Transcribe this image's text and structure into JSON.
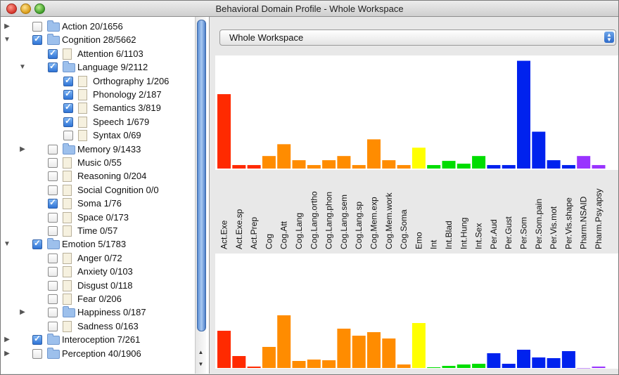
{
  "window": {
    "title": "Behavioral Domain Profile - Whole Workspace"
  },
  "tree": [
    {
      "level": 0,
      "disclosure": "collapsed",
      "checked": false,
      "icon": "folder-icon",
      "label": "Action 20/1656"
    },
    {
      "level": 0,
      "disclosure": "expanded",
      "checked": true,
      "icon": "folder-icon",
      "label": "Cognition 28/5662"
    },
    {
      "level": 1,
      "disclosure": "none",
      "checked": true,
      "icon": "document-icon",
      "label": "Attention 6/1103"
    },
    {
      "level": 1,
      "disclosure": "expanded",
      "checked": true,
      "icon": "folder-icon",
      "label": "Language 9/2112"
    },
    {
      "level": 2,
      "disclosure": "none",
      "checked": true,
      "icon": "document-icon",
      "label": "Orthography 1/206"
    },
    {
      "level": 2,
      "disclosure": "none",
      "checked": true,
      "icon": "document-icon",
      "label": "Phonology 2/187"
    },
    {
      "level": 2,
      "disclosure": "none",
      "checked": true,
      "icon": "document-icon",
      "label": "Semantics 3/819"
    },
    {
      "level": 2,
      "disclosure": "none",
      "checked": true,
      "icon": "document-icon",
      "label": "Speech 1/679"
    },
    {
      "level": 2,
      "disclosure": "none",
      "checked": false,
      "icon": "document-icon",
      "label": "Syntax 0/69"
    },
    {
      "level": 1,
      "disclosure": "collapsed",
      "checked": false,
      "icon": "folder-icon",
      "label": "Memory 9/1433"
    },
    {
      "level": 1,
      "disclosure": "none",
      "checked": false,
      "icon": "document-icon",
      "label": "Music 0/55"
    },
    {
      "level": 1,
      "disclosure": "none",
      "checked": false,
      "icon": "document-icon",
      "label": "Reasoning 0/204"
    },
    {
      "level": 1,
      "disclosure": "none",
      "checked": false,
      "icon": "document-icon",
      "label": "Social Cognition 0/0"
    },
    {
      "level": 1,
      "disclosure": "none",
      "checked": true,
      "icon": "document-icon",
      "label": "Soma 1/76"
    },
    {
      "level": 1,
      "disclosure": "none",
      "checked": false,
      "icon": "document-icon",
      "label": "Space 0/173"
    },
    {
      "level": 1,
      "disclosure": "none",
      "checked": false,
      "icon": "document-icon",
      "label": "Time 0/57"
    },
    {
      "level": 0,
      "disclosure": "expanded",
      "checked": true,
      "icon": "folder-icon",
      "label": "Emotion 5/1783"
    },
    {
      "level": 1,
      "disclosure": "none",
      "checked": false,
      "icon": "document-icon",
      "label": "Anger 0/72"
    },
    {
      "level": 1,
      "disclosure": "none",
      "checked": false,
      "icon": "document-icon",
      "label": "Anxiety 0/103"
    },
    {
      "level": 1,
      "disclosure": "none",
      "checked": false,
      "icon": "document-icon",
      "label": "Disgust 0/118"
    },
    {
      "level": 1,
      "disclosure": "none",
      "checked": false,
      "icon": "document-icon",
      "label": "Fear 0/206"
    },
    {
      "level": 1,
      "disclosure": "collapsed",
      "checked": false,
      "icon": "folder-icon",
      "label": "Happiness 0/187"
    },
    {
      "level": 1,
      "disclosure": "none",
      "checked": false,
      "icon": "document-icon",
      "label": "Sadness 0/163"
    },
    {
      "level": 0,
      "disclosure": "collapsed",
      "checked": true,
      "icon": "folder-icon",
      "label": "Interoception 7/261"
    },
    {
      "level": 0,
      "disclosure": "collapsed",
      "checked": false,
      "icon": "folder-icon",
      "label": "Perception 40/1906"
    }
  ],
  "workspace_select": {
    "value": "Whole Workspace"
  },
  "chart_data": [
    {
      "type": "bar",
      "categories": [
        "Act.Exe",
        "Act.Exe.sp",
        "Act.Prep",
        "Cog",
        "Cog.Att",
        "Cog.Lang",
        "Cog.Lang.ortho",
        "Cog.Lang.phon",
        "Cog.Lang.sem",
        "Cog.Lang.sp",
        "Cog.Mem.exp",
        "Cog.Mem.work",
        "Cog.Soma",
        "Emo",
        "Int",
        "Int.Blad",
        "Int.Hung",
        "Int.Sex",
        "Per.Aud",
        "Per.Gust",
        "Per.Som",
        "Per.Som.pain",
        "Per.Vis.mot",
        "Per.Vis.shape",
        "Pharm.NSAID",
        "Pharm.Psy.apsy"
      ],
      "values": [
        107,
        5,
        5,
        18,
        35,
        12,
        5,
        12,
        18,
        5,
        42,
        12,
        5,
        30,
        5,
        11,
        7,
        18,
        5,
        5,
        155,
        53,
        12,
        5,
        18,
        5
      ],
      "colors": [
        "#ff2a00",
        "#ff2a00",
        "#ff2a00",
        "#ff8c00",
        "#ff8c00",
        "#ff8c00",
        "#ff8c00",
        "#ff8c00",
        "#ff8c00",
        "#ff8c00",
        "#ff8c00",
        "#ff8c00",
        "#ff8c00",
        "#ffff00",
        "#00dd00",
        "#00dd00",
        "#00dd00",
        "#00dd00",
        "#0022ee",
        "#0022ee",
        "#0022ee",
        "#0022ee",
        "#0022ee",
        "#0022ee",
        "#9933ff",
        "#9933ff"
      ]
    },
    {
      "type": "bar",
      "categories": [
        "Act.Exe",
        "Act.Exe.sp",
        "Act.Prep",
        "Cog",
        "Cog.Att",
        "Cog.Lang",
        "Cog.Lang.ortho",
        "Cog.Lang.phon",
        "Cog.Lang.sem",
        "Cog.Lang.sp",
        "Cog.Mem.exp",
        "Cog.Mem.work",
        "Cog.Soma",
        "Emo",
        "Int",
        "Int.Blad",
        "Int.Hung",
        "Int.Sex",
        "Per.Aud",
        "Per.Gust",
        "Per.Som",
        "Per.Som.pain",
        "Per.Vis.mot",
        "Per.Vis.shape",
        "Pharm.NSAID",
        "Pharm.Psy.apsy"
      ],
      "values": [
        53,
        17,
        2,
        30,
        75,
        10,
        12,
        11,
        56,
        46,
        51,
        42,
        5,
        64,
        1,
        3,
        5,
        6,
        21,
        6,
        26,
        15,
        14,
        24,
        0,
        2
      ],
      "colors": [
        "#ff2a00",
        "#ff2a00",
        "#ff2a00",
        "#ff8c00",
        "#ff8c00",
        "#ff8c00",
        "#ff8c00",
        "#ff8c00",
        "#ff8c00",
        "#ff8c00",
        "#ff8c00",
        "#ff8c00",
        "#ff8c00",
        "#ffff00",
        "#00dd00",
        "#00dd00",
        "#00dd00",
        "#00dd00",
        "#0022ee",
        "#0022ee",
        "#0022ee",
        "#0022ee",
        "#0022ee",
        "#0022ee",
        "#9933ff",
        "#9933ff"
      ]
    }
  ]
}
